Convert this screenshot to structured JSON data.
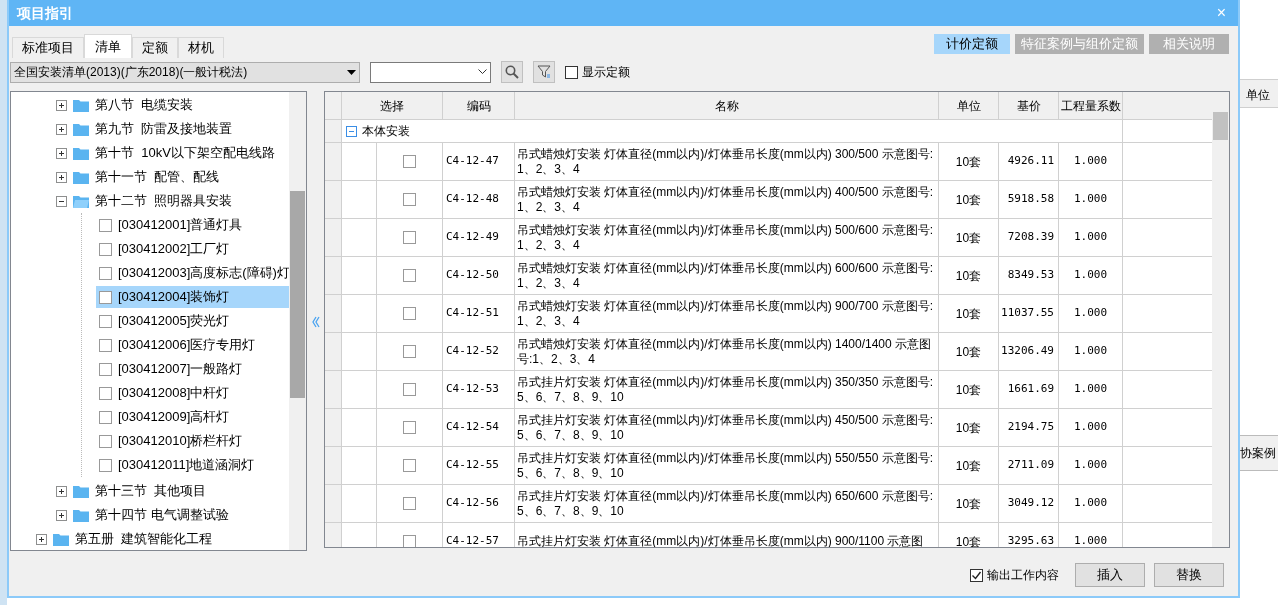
{
  "window": {
    "title": "项目指引",
    "close": "×"
  },
  "tabs": [
    {
      "label": "标准项目",
      "selected": false
    },
    {
      "label": "清单",
      "selected": true
    },
    {
      "label": "定额",
      "selected": false
    },
    {
      "label": "材机",
      "selected": false
    }
  ],
  "view_buttons": [
    {
      "label": "计价定额",
      "selected": true
    },
    {
      "label": "特征案例与组价定额",
      "selected": false
    },
    {
      "label": "相关说明",
      "selected": false
    }
  ],
  "toolbar": {
    "library": "全国安装清单(2013)(广东2018)(一般计税法)",
    "show_quota": {
      "label": "显示定额",
      "checked": false
    }
  },
  "tree": {
    "visible_branch": [
      {
        "label": "第八节  电缆安装",
        "expanded": false
      },
      {
        "label": "第九节  防雷及接地装置",
        "expanded": false
      },
      {
        "label": "第十节  10kV以下架空配电线路",
        "expanded": false
      },
      {
        "label": "第十一节  配管、配线",
        "expanded": false
      },
      {
        "label": "第十二节  照明器具安装",
        "expanded": true,
        "children": [
          {
            "label": "[030412001]普通灯具",
            "checked": false,
            "selected": false
          },
          {
            "label": "[030412002]工厂灯",
            "checked": false,
            "selected": false
          },
          {
            "label": "[030412003]高度标志(障碍)灯",
            "checked": false,
            "selected": false
          },
          {
            "label": "[030412004]装饰灯",
            "checked": false,
            "selected": true
          },
          {
            "label": "[030412005]荧光灯",
            "checked": false,
            "selected": false
          },
          {
            "label": "[030412006]医疗专用灯",
            "checked": false,
            "selected": false
          },
          {
            "label": "[030412007]一般路灯",
            "checked": false,
            "selected": false
          },
          {
            "label": "[030412008]中杆灯",
            "checked": false,
            "selected": false
          },
          {
            "label": "[030412009]高杆灯",
            "checked": false,
            "selected": false
          },
          {
            "label": "[030412010]桥栏杆灯",
            "checked": false,
            "selected": false
          },
          {
            "label": "[030412011]地道涵洞灯",
            "checked": false,
            "selected": false
          }
        ]
      },
      {
        "label": "第十三节  其他项目",
        "expanded": false
      },
      {
        "label": "第十四节 电气调整试验",
        "expanded": false
      }
    ],
    "roots": [
      {
        "label": "第五册  建筑智能化工程",
        "expanded": false
      }
    ]
  },
  "table": {
    "columns": [
      "选择",
      "编码",
      "名称",
      "单位",
      "基价",
      "工程量系数"
    ],
    "group": {
      "label": "本体安装",
      "expanded": true
    },
    "rows": [
      {
        "checked": false,
        "code": "C4-12-47",
        "name": "吊式蜡烛灯安装 灯体直径(mm以内)/灯体垂吊长度(mm以内) 300/500 示意图号:1、2、3、4",
        "unit": "10套",
        "price": "4926.11",
        "factor": "1.000"
      },
      {
        "checked": false,
        "code": "C4-12-48",
        "name": "吊式蜡烛灯安装 灯体直径(mm以内)/灯体垂吊长度(mm以内) 400/500 示意图号:1、2、3、4",
        "unit": "10套",
        "price": "5918.58",
        "factor": "1.000"
      },
      {
        "checked": false,
        "code": "C4-12-49",
        "name": "吊式蜡烛灯安装 灯体直径(mm以内)/灯体垂吊长度(mm以内) 500/600 示意图号:1、2、3、4",
        "unit": "10套",
        "price": "7208.39",
        "factor": "1.000"
      },
      {
        "checked": false,
        "code": "C4-12-50",
        "name": "吊式蜡烛灯安装 灯体直径(mm以内)/灯体垂吊长度(mm以内) 600/600 示意图号:1、2、3、4",
        "unit": "10套",
        "price": "8349.53",
        "factor": "1.000"
      },
      {
        "checked": false,
        "code": "C4-12-51",
        "name": "吊式蜡烛灯安装 灯体直径(mm以内)/灯体垂吊长度(mm以内) 900/700 示意图号:1、2、3、4",
        "unit": "10套",
        "price": "11037.55",
        "factor": "1.000"
      },
      {
        "checked": false,
        "code": "C4-12-52",
        "name": "吊式蜡烛灯安装 灯体直径(mm以内)/灯体垂吊长度(mm以内) 1400/1400 示意图号:1、2、3、4",
        "unit": "10套",
        "price": "13206.49",
        "factor": "1.000"
      },
      {
        "checked": false,
        "code": "C4-12-53",
        "name": "吊式挂片灯安装 灯体直径(mm以内)/灯体垂吊长度(mm以内) 350/350 示意图号: 5、6、7、8、9、10",
        "unit": "10套",
        "price": "1661.69",
        "factor": "1.000"
      },
      {
        "checked": false,
        "code": "C4-12-54",
        "name": "吊式挂片灯安装 灯体直径(mm以内)/灯体垂吊长度(mm以内) 450/500 示意图号: 5、6、7、8、9、10",
        "unit": "10套",
        "price": "2194.75",
        "factor": "1.000"
      },
      {
        "checked": false,
        "code": "C4-12-55",
        "name": "吊式挂片灯安装 灯体直径(mm以内)/灯体垂吊长度(mm以内) 550/550 示意图号: 5、6、7、8、9、10",
        "unit": "10套",
        "price": "2711.09",
        "factor": "1.000"
      },
      {
        "checked": false,
        "code": "C4-12-56",
        "name": "吊式挂片灯安装 灯体直径(mm以内)/灯体垂吊长度(mm以内) 650/600 示意图号: 5、6、7、8、9、10",
        "unit": "10套",
        "price": "3049.12",
        "factor": "1.000"
      },
      {
        "checked": false,
        "code": "C4-12-57",
        "name": "吊式挂片灯安装 灯体直径(mm以内)/灯体垂吊长度(mm以内) 900/1100 示意图",
        "unit": "10套",
        "price": "3295.63",
        "factor": "1.000"
      }
    ]
  },
  "footer": {
    "output_work": {
      "label": "输出工作内容",
      "checked": true
    },
    "buttons": [
      "插入",
      "替换"
    ]
  },
  "background_window": {
    "column_header": "单位",
    "button": "协案例"
  }
}
